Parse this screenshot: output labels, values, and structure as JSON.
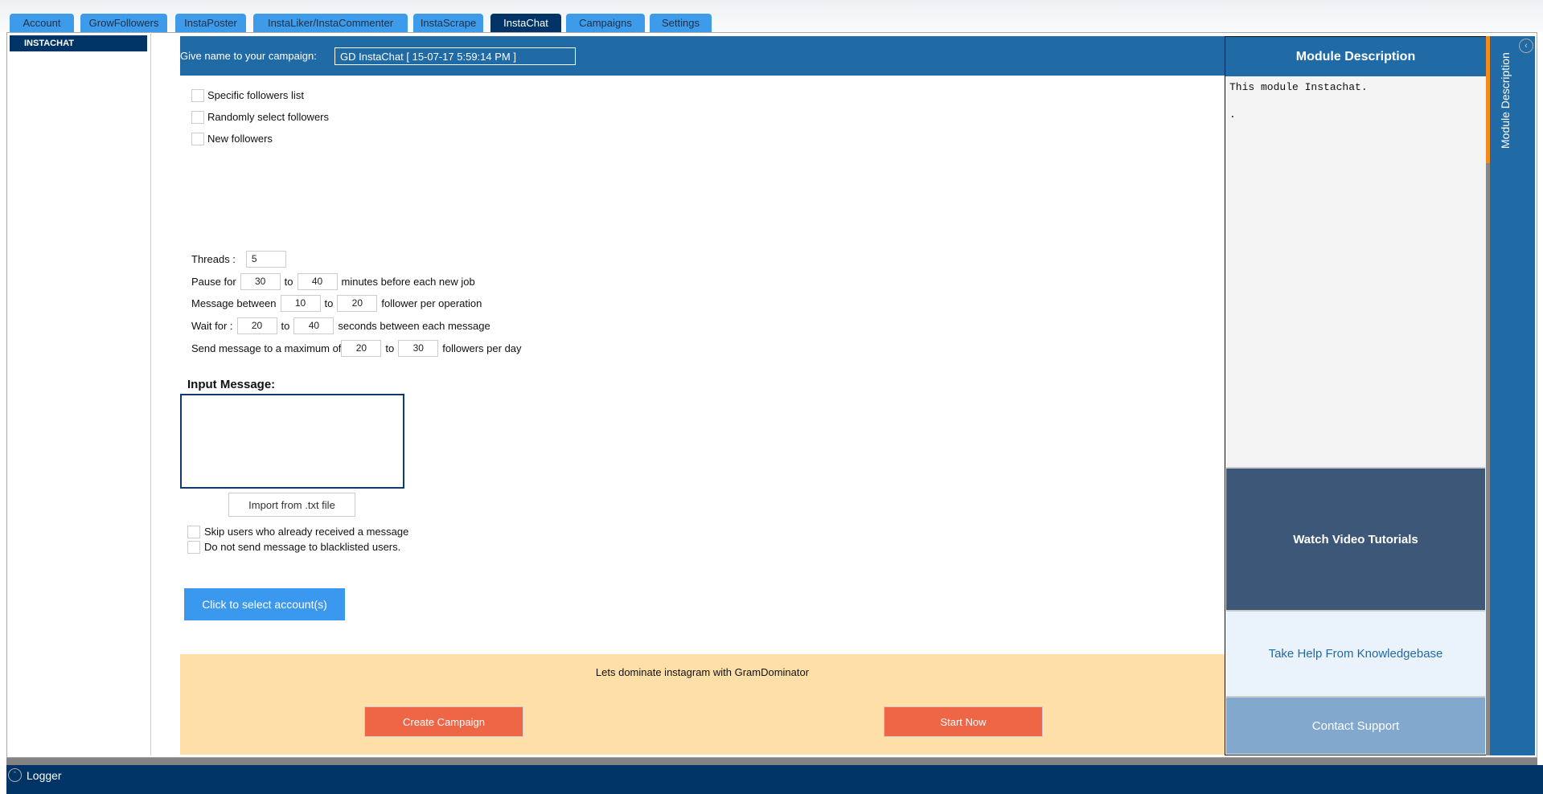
{
  "tabs": [
    {
      "label": "Account"
    },
    {
      "label": "GrowFollowers"
    },
    {
      "label": "InstaPoster"
    },
    {
      "label": "InstaLiker/InstaCommenter"
    },
    {
      "label": "InstaScrape"
    },
    {
      "label": "InstaChat",
      "active": true
    },
    {
      "label": "Campaigns"
    },
    {
      "label": "Settings"
    }
  ],
  "sidebar": {
    "items": [
      {
        "label": "INSTACHAT"
      }
    ]
  },
  "header": {
    "campaign_label": "Give name to your campaign:",
    "campaign_value": "GD InstaChat [ 15-07-17 5:59:14 PM ]"
  },
  "source_options": [
    {
      "label": "Specific followers list",
      "checked": false
    },
    {
      "label": "Randomly select followers",
      "checked": false
    },
    {
      "label": "New followers",
      "checked": false
    }
  ],
  "settings": {
    "threads_label": "Threads :",
    "threads": "5",
    "pause_label": "Pause for",
    "pause_min": "30",
    "to": "to",
    "pause_max": "40",
    "pause_suffix": "minutes before each new job",
    "message_label": "Message between",
    "message_min": "10",
    "message_max": "20",
    "message_suffix": "follower per operation",
    "wait_label": "Wait for :",
    "wait_min": "20",
    "wait_max": "40",
    "wait_suffix": "seconds between each message",
    "max_label": "Send message to a maximum of",
    "max_min": "20",
    "max_max": "30",
    "max_suffix": "followers per day"
  },
  "message": {
    "label": "Input Message:",
    "value": "",
    "import_label": "Import from .txt file"
  },
  "filters": [
    {
      "label": "Skip users who already received a message",
      "checked": false
    },
    {
      "label": "Do not send message to blacklisted users.",
      "checked": false
    }
  ],
  "select_accounts_label": "Click to select account(s)",
  "banner": {
    "text": "Lets dominate instagram with GramDominator",
    "create_label": "Create Campaign",
    "start_label": "Start Now"
  },
  "right_panel": {
    "title": "Module Description",
    "description": "This module Instachat.\n\n.",
    "video_label": "Watch Video Tutorials",
    "kb_label": "Take Help From Knowledgebase",
    "support_label": "Contact Support",
    "side_tab_label": "Module Description"
  },
  "logger": {
    "label": "Logger"
  },
  "colors": {
    "primary": "#206aa5",
    "active_tab": "#003366",
    "tab": "#3d9be9",
    "accent": "#ee6645",
    "banner": "#fddfa7",
    "scroll_thumb": "#f28a1e"
  }
}
